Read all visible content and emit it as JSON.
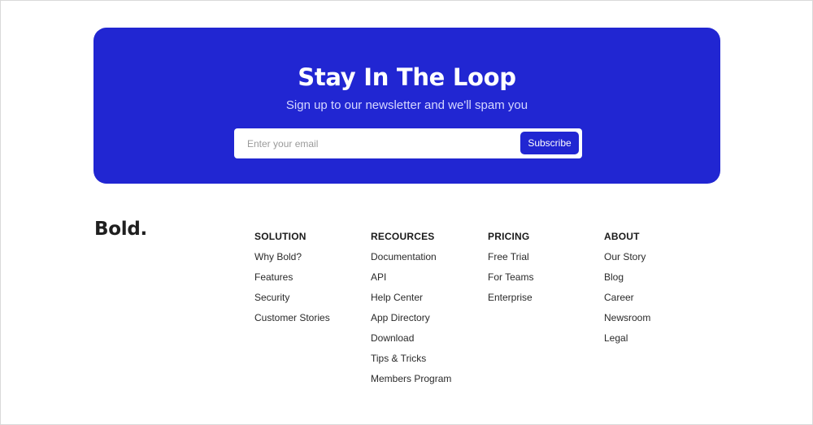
{
  "newsletter": {
    "title": "Stay In The Loop",
    "subtitle": "Sign up to our newsletter and we'll spam you",
    "email_placeholder": "Enter your email",
    "email_value": "",
    "subscribe_label": "Subscribe",
    "background_color": "#2126d2"
  },
  "footer": {
    "logo": "Bold.",
    "columns": [
      {
        "heading": "SOLUTION",
        "links": [
          "Why Bold?",
          "Features",
          "Security",
          "Customer Stories"
        ]
      },
      {
        "heading": "RECOURCES",
        "links": [
          "Documentation",
          "API",
          "Help Center",
          "App Directory",
          "Download",
          "Tips & Tricks",
          "Members Program"
        ]
      },
      {
        "heading": "PRICING",
        "links": [
          "Free Trial",
          "For Teams",
          "Enterprise"
        ]
      },
      {
        "heading": "ABOUT",
        "links": [
          "Our Story",
          "Blog",
          "Career",
          "Newsroom",
          "Legal"
        ]
      }
    ]
  }
}
